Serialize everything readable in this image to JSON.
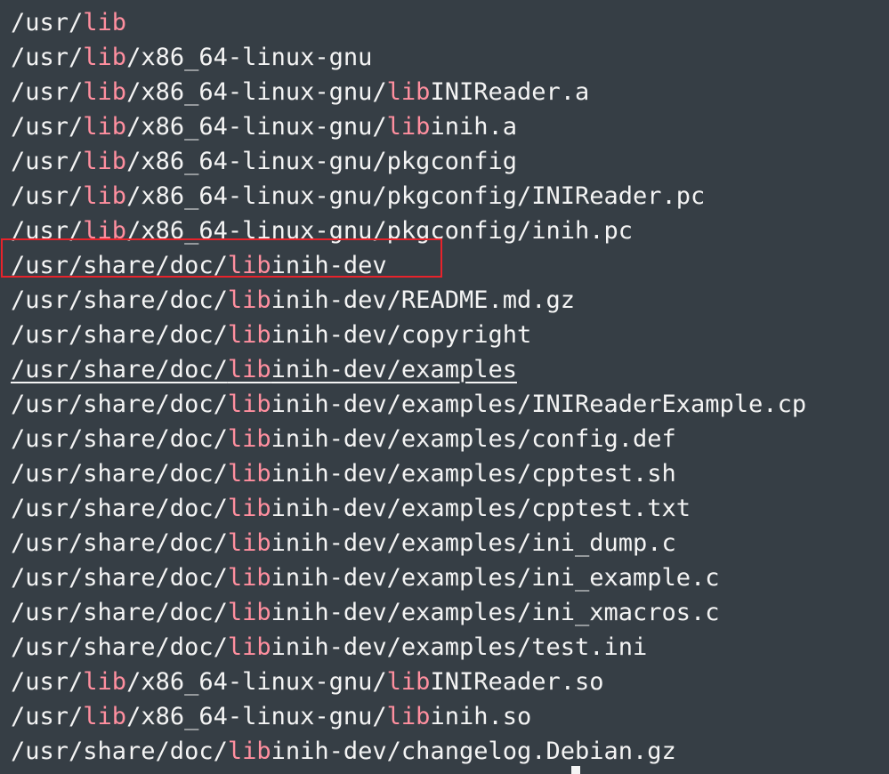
{
  "colors": {
    "background": "#363e45",
    "text": "#f4f4f4",
    "match_highlight": "#ff8f9f",
    "annotation_box": "#e8232b"
  },
  "highlight_term": "lib",
  "highlighted_line_index": 7,
  "underlined_line_index": 10,
  "lines": [
    [
      {
        "t": "/usr/"
      },
      {
        "t": "lib",
        "hl": true
      }
    ],
    [
      {
        "t": "/usr/"
      },
      {
        "t": "lib",
        "hl": true
      },
      {
        "t": "/x86_64-linux-gnu"
      }
    ],
    [
      {
        "t": "/usr/"
      },
      {
        "t": "lib",
        "hl": true
      },
      {
        "t": "/x86_64-linux-gnu/"
      },
      {
        "t": "lib",
        "hl": true
      },
      {
        "t": "INIReader.a"
      }
    ],
    [
      {
        "t": "/usr/"
      },
      {
        "t": "lib",
        "hl": true
      },
      {
        "t": "/x86_64-linux-gnu/"
      },
      {
        "t": "lib",
        "hl": true
      },
      {
        "t": "inih.a"
      }
    ],
    [
      {
        "t": "/usr/"
      },
      {
        "t": "lib",
        "hl": true
      },
      {
        "t": "/x86_64-linux-gnu/pkgconfig"
      }
    ],
    [
      {
        "t": "/usr/"
      },
      {
        "t": "lib",
        "hl": true
      },
      {
        "t": "/x86_64-linux-gnu/pkgconfig/INIReader.pc"
      }
    ],
    [
      {
        "t": "/usr/"
      },
      {
        "t": "lib",
        "hl": true
      },
      {
        "t": "/x86_64-linux-gnu/pkgconfig/inih.pc"
      }
    ],
    [
      {
        "t": "/usr/share/doc/"
      },
      {
        "t": "lib",
        "hl": true
      },
      {
        "t": "inih-dev"
      }
    ],
    [
      {
        "t": "/usr/share/doc/"
      },
      {
        "t": "lib",
        "hl": true
      },
      {
        "t": "inih-dev/README.md.gz"
      }
    ],
    [
      {
        "t": "/usr/share/doc/"
      },
      {
        "t": "lib",
        "hl": true
      },
      {
        "t": "inih-dev/copyright"
      }
    ],
    [
      {
        "t": "/usr/share/doc/"
      },
      {
        "t": "lib",
        "hl": true
      },
      {
        "t": "inih-dev/examples"
      }
    ],
    [
      {
        "t": "/usr/share/doc/"
      },
      {
        "t": "lib",
        "hl": true
      },
      {
        "t": "inih-dev/examples/INIReaderExample.cp"
      }
    ],
    [
      {
        "t": "/usr/share/doc/"
      },
      {
        "t": "lib",
        "hl": true
      },
      {
        "t": "inih-dev/examples/config.def"
      }
    ],
    [
      {
        "t": "/usr/share/doc/"
      },
      {
        "t": "lib",
        "hl": true
      },
      {
        "t": "inih-dev/examples/cpptest.sh"
      }
    ],
    [
      {
        "t": "/usr/share/doc/"
      },
      {
        "t": "lib",
        "hl": true
      },
      {
        "t": "inih-dev/examples/cpptest.txt"
      }
    ],
    [
      {
        "t": "/usr/share/doc/"
      },
      {
        "t": "lib",
        "hl": true
      },
      {
        "t": "inih-dev/examples/ini_dump.c"
      }
    ],
    [
      {
        "t": "/usr/share/doc/"
      },
      {
        "t": "lib",
        "hl": true
      },
      {
        "t": "inih-dev/examples/ini_example.c"
      }
    ],
    [
      {
        "t": "/usr/share/doc/"
      },
      {
        "t": "lib",
        "hl": true
      },
      {
        "t": "inih-dev/examples/ini_xmacros.c"
      }
    ],
    [
      {
        "t": "/usr/share/doc/"
      },
      {
        "t": "lib",
        "hl": true
      },
      {
        "t": "inih-dev/examples/test.ini"
      }
    ],
    [
      {
        "t": "/usr/"
      },
      {
        "t": "lib",
        "hl": true
      },
      {
        "t": "/x86_64-linux-gnu/"
      },
      {
        "t": "lib",
        "hl": true
      },
      {
        "t": "INIReader.so"
      }
    ],
    [
      {
        "t": "/usr/"
      },
      {
        "t": "lib",
        "hl": true
      },
      {
        "t": "/x86_64-linux-gnu/"
      },
      {
        "t": "lib",
        "hl": true
      },
      {
        "t": "inih.so"
      }
    ],
    [
      {
        "t": "/usr/share/doc/"
      },
      {
        "t": "lib",
        "hl": true
      },
      {
        "t": "inih-dev/changelog.Debian.gz"
      }
    ]
  ]
}
